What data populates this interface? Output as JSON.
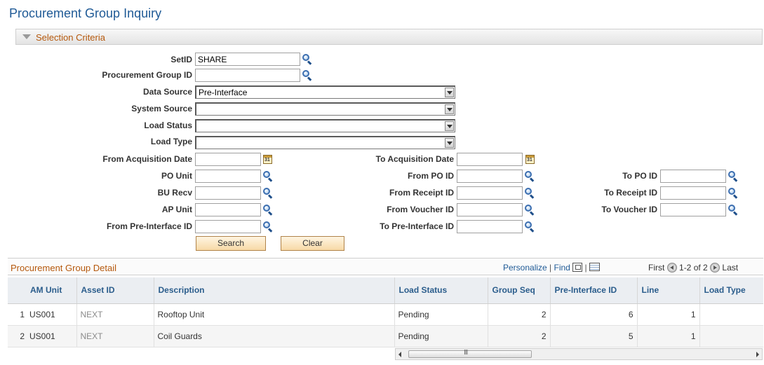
{
  "page": {
    "title": "Procurement Group Inquiry"
  },
  "selection": {
    "header": "Selection Criteria",
    "setid_label": "SetID",
    "setid_value": "SHARE",
    "group_id_label": "Procurement Group ID",
    "group_id_value": "",
    "data_source_label": "Data Source",
    "data_source_value": "Pre-Interface",
    "system_source_label": "System Source",
    "system_source_value": "",
    "load_status_label": "Load Status",
    "load_status_value": "",
    "load_type_label": "Load Type",
    "load_type_value": "",
    "from_acq_date_label": "From Acquisition Date",
    "to_acq_date_label": "To Acquisition Date",
    "po_unit_label": "PO Unit",
    "from_po_id_label": "From PO ID",
    "to_po_id_label": "To PO ID",
    "bu_recv_label": "BU Recv",
    "from_receipt_label": "From Receipt ID",
    "to_receipt_label": "To Receipt ID",
    "ap_unit_label": "AP Unit",
    "from_voucher_label": "From Voucher ID",
    "to_voucher_label": "To Voucher ID",
    "from_pre_label": "From Pre-Interface ID",
    "to_pre_label": "To Pre-Interface ID",
    "search_button": "Search",
    "clear_button": "Clear"
  },
  "grid": {
    "title": "Procurement Group Detail",
    "personalize": "Personalize",
    "find": "Find",
    "sep": "|",
    "first": "First",
    "range": "1-2 of 2",
    "last": "Last",
    "columns": [
      "AM Unit",
      "Asset ID",
      "Description",
      "Load Status",
      "Group Seq",
      "Pre-Interface ID",
      "Line",
      "Load Type"
    ],
    "rows": [
      {
        "n": "1",
        "am_unit": "US001",
        "asset_id": "NEXT",
        "description": "Rooftop Unit",
        "load_status": "Pending",
        "group_seq": "2",
        "pre_id": "6",
        "line": "1",
        "load_type": ""
      },
      {
        "n": "2",
        "am_unit": "US001",
        "asset_id": "NEXT",
        "description": "Coil Guards",
        "load_status": "Pending",
        "group_seq": "2",
        "pre_id": "5",
        "line": "1",
        "load_type": ""
      }
    ],
    "scroll_grip": "III"
  },
  "icons": {
    "lookup": "magnifier-icon",
    "calendar": "calendar-icon"
  },
  "colors": {
    "title": "#1f5a96",
    "section": "#b5580c",
    "header_text": "#2b5d8c"
  }
}
